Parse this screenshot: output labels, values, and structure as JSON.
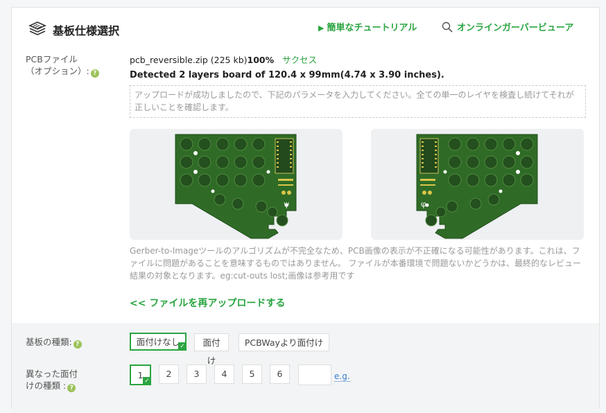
{
  "header": {
    "title": "基板仕様選択",
    "tutorial_label": "簡単なチュートリアル",
    "viewer_label": "オンラインガーバービューア"
  },
  "pcb_file": {
    "label_line1": "PCBファイル",
    "label_line2": "（オプション）:",
    "filename": "pcb_reversible.zip (225 kb)",
    "percent": "100%",
    "status": "サクセス",
    "detected": "Detected 2 layers board of 120.4 x 99mm(4.74 x 3.90 inches).",
    "notice": "アップロードが成功しましたので、下記のパラメータを入力してください。全ての単一のレイヤを検査し続けてそれが正しいことを確認します。",
    "disclaimer": "Gerber-to-Imageツールのアルゴリズムが不完全なため、PCB画像の表示が不正確になる可能性があります。これは、ファイルに問題があることを意味するものではありません。 ファイルが本番環境で問題ないかどうかは、最終的なレビュー結果の対象となります。eg:cut-outs lost;画像は参考用です",
    "reupload": "<< ファイルを再アップロードする"
  },
  "board_type": {
    "label": "基板の種類:",
    "options": [
      "面付けなし",
      "面付け",
      "PCBWayより面付け"
    ],
    "selected": "面付けなし"
  },
  "different_designs": {
    "label_line1": "異なった面付",
    "label_line2": "けの種類 :",
    "options": [
      "1",
      "2",
      "3",
      "4",
      "5",
      "6"
    ],
    "selected": "1",
    "eg_label": "e.g."
  },
  "colors": {
    "accent": "#2aa541",
    "pcb_green": "#2f6b26",
    "link_blue": "#3b7fd0"
  }
}
